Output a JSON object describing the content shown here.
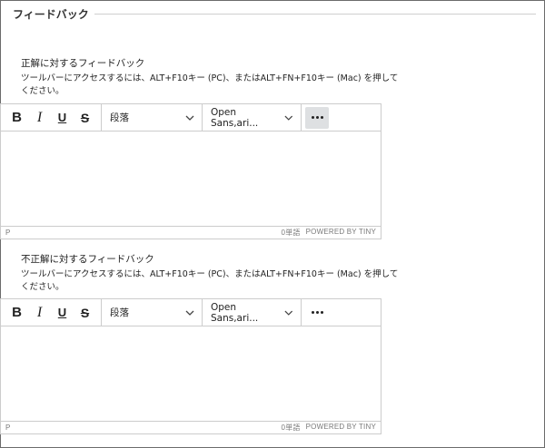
{
  "legend": {
    "title": "フィードバック"
  },
  "sections": [
    {
      "label": "正解に対するフィードバック",
      "help": "ツールバーにアクセスするには、ALT+F10キー (PC)、またはALT+FN+F10キー (Mac) を押してください。",
      "editor": {
        "bold": "B",
        "italic": "I",
        "underline": "U",
        "strike": "S",
        "block_format": "段落",
        "font_family": "Open Sans,ari...",
        "status_path": "P",
        "word_count": "0単語",
        "powered_by": "POWERED BY TINY"
      }
    },
    {
      "label": "不正解に対するフィードバック",
      "help": "ツールバーにアクセスするには、ALT+F10キー (PC)、またはALT+FN+F10キー (Mac) を押してください。",
      "editor": {
        "bold": "B",
        "italic": "I",
        "underline": "U",
        "strike": "S",
        "block_format": "段落",
        "font_family": "Open Sans,ari...",
        "status_path": "P",
        "word_count": "0単語",
        "powered_by": "POWERED BY TINY"
      }
    }
  ],
  "icons": {
    "more": "more-horizontal-icon",
    "dropdown": "chevron-down-icon"
  },
  "colors": {
    "border": "#cccccc",
    "active_button_bg": "#dee0e2",
    "status_text": "#7a7a7a"
  }
}
